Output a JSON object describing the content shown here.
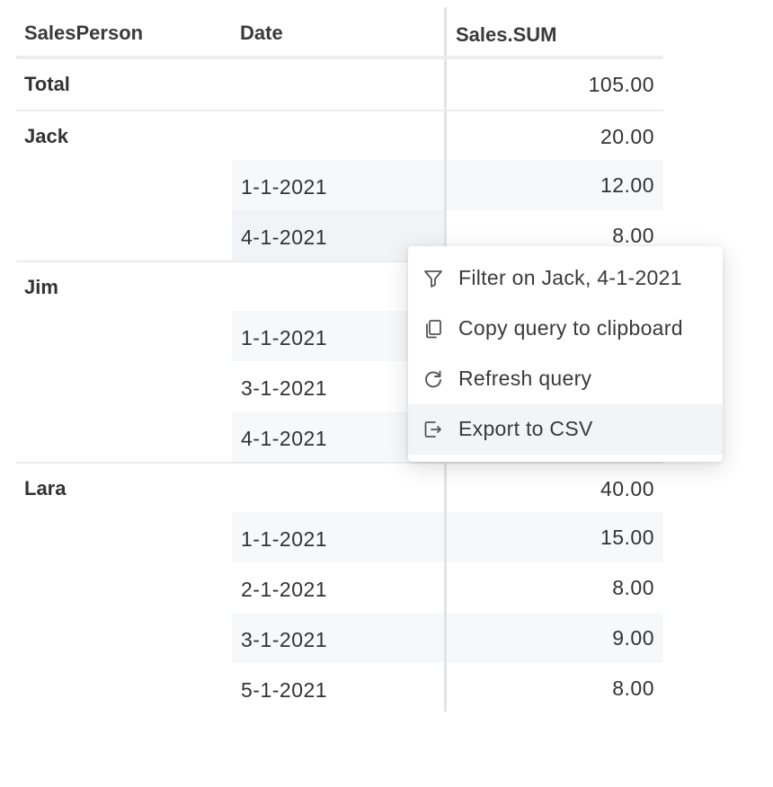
{
  "table": {
    "headers": {
      "salesperson": "SalesPerson",
      "date": "Date",
      "sum": "Sales.SUM"
    },
    "total": {
      "label": "Total",
      "value": "105.00"
    },
    "groups": [
      {
        "name": "Jack",
        "subtotal": "20.00",
        "rows": [
          {
            "date": "1-1-2021",
            "value": "12.00"
          },
          {
            "date": "4-1-2021",
            "value": "8.00"
          }
        ]
      },
      {
        "name": "Jim",
        "subtotal": "",
        "rows": [
          {
            "date": "1-1-2021",
            "value": ""
          },
          {
            "date": "3-1-2021",
            "value": ""
          },
          {
            "date": "4-1-2021",
            "value": ""
          }
        ]
      },
      {
        "name": "Lara",
        "subtotal": "40.00",
        "rows": [
          {
            "date": "1-1-2021",
            "value": "15.00"
          },
          {
            "date": "2-1-2021",
            "value": "8.00"
          },
          {
            "date": "3-1-2021",
            "value": "9.00"
          },
          {
            "date": "5-1-2021",
            "value": "8.00"
          }
        ]
      }
    ]
  },
  "context_menu": {
    "items": [
      {
        "label": "Filter on Jack, 4-1-2021",
        "icon": "filter-icon"
      },
      {
        "label": "Copy query to clipboard",
        "icon": "copy-icon"
      },
      {
        "label": "Refresh query",
        "icon": "refresh-icon"
      },
      {
        "label": "Export to CSV",
        "icon": "export-icon"
      }
    ]
  },
  "colors": {
    "row_shade": "#f7f8f9",
    "hover": "#f3f4f6",
    "divider": "#e3e3e3"
  }
}
